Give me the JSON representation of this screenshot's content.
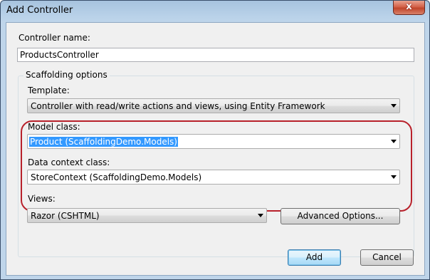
{
  "window": {
    "title": "Add Controller",
    "close_label": "x"
  },
  "controller_name": {
    "label": "Controller name:",
    "value": "ProductsController"
  },
  "scaffolding": {
    "group_title": "Scaffolding options",
    "template": {
      "label": "Template:",
      "value": "Controller with read/write actions and views, using Entity Framework"
    },
    "model_class": {
      "label": "Model class:",
      "value": "Product (ScaffoldingDemo.Models)"
    },
    "data_context": {
      "label": "Data context class:",
      "value": "StoreContext (ScaffoldingDemo.Models)"
    },
    "views": {
      "label": "Views:",
      "value": "Razor (CSHTML)"
    },
    "advanced_label": "Advanced Options..."
  },
  "buttons": {
    "add_label": "Add",
    "cancel_label": "Cancel"
  },
  "colors": {
    "highlight": "#b8212b",
    "selection": "#3399ff",
    "titlebar": "#b9d2e9"
  }
}
